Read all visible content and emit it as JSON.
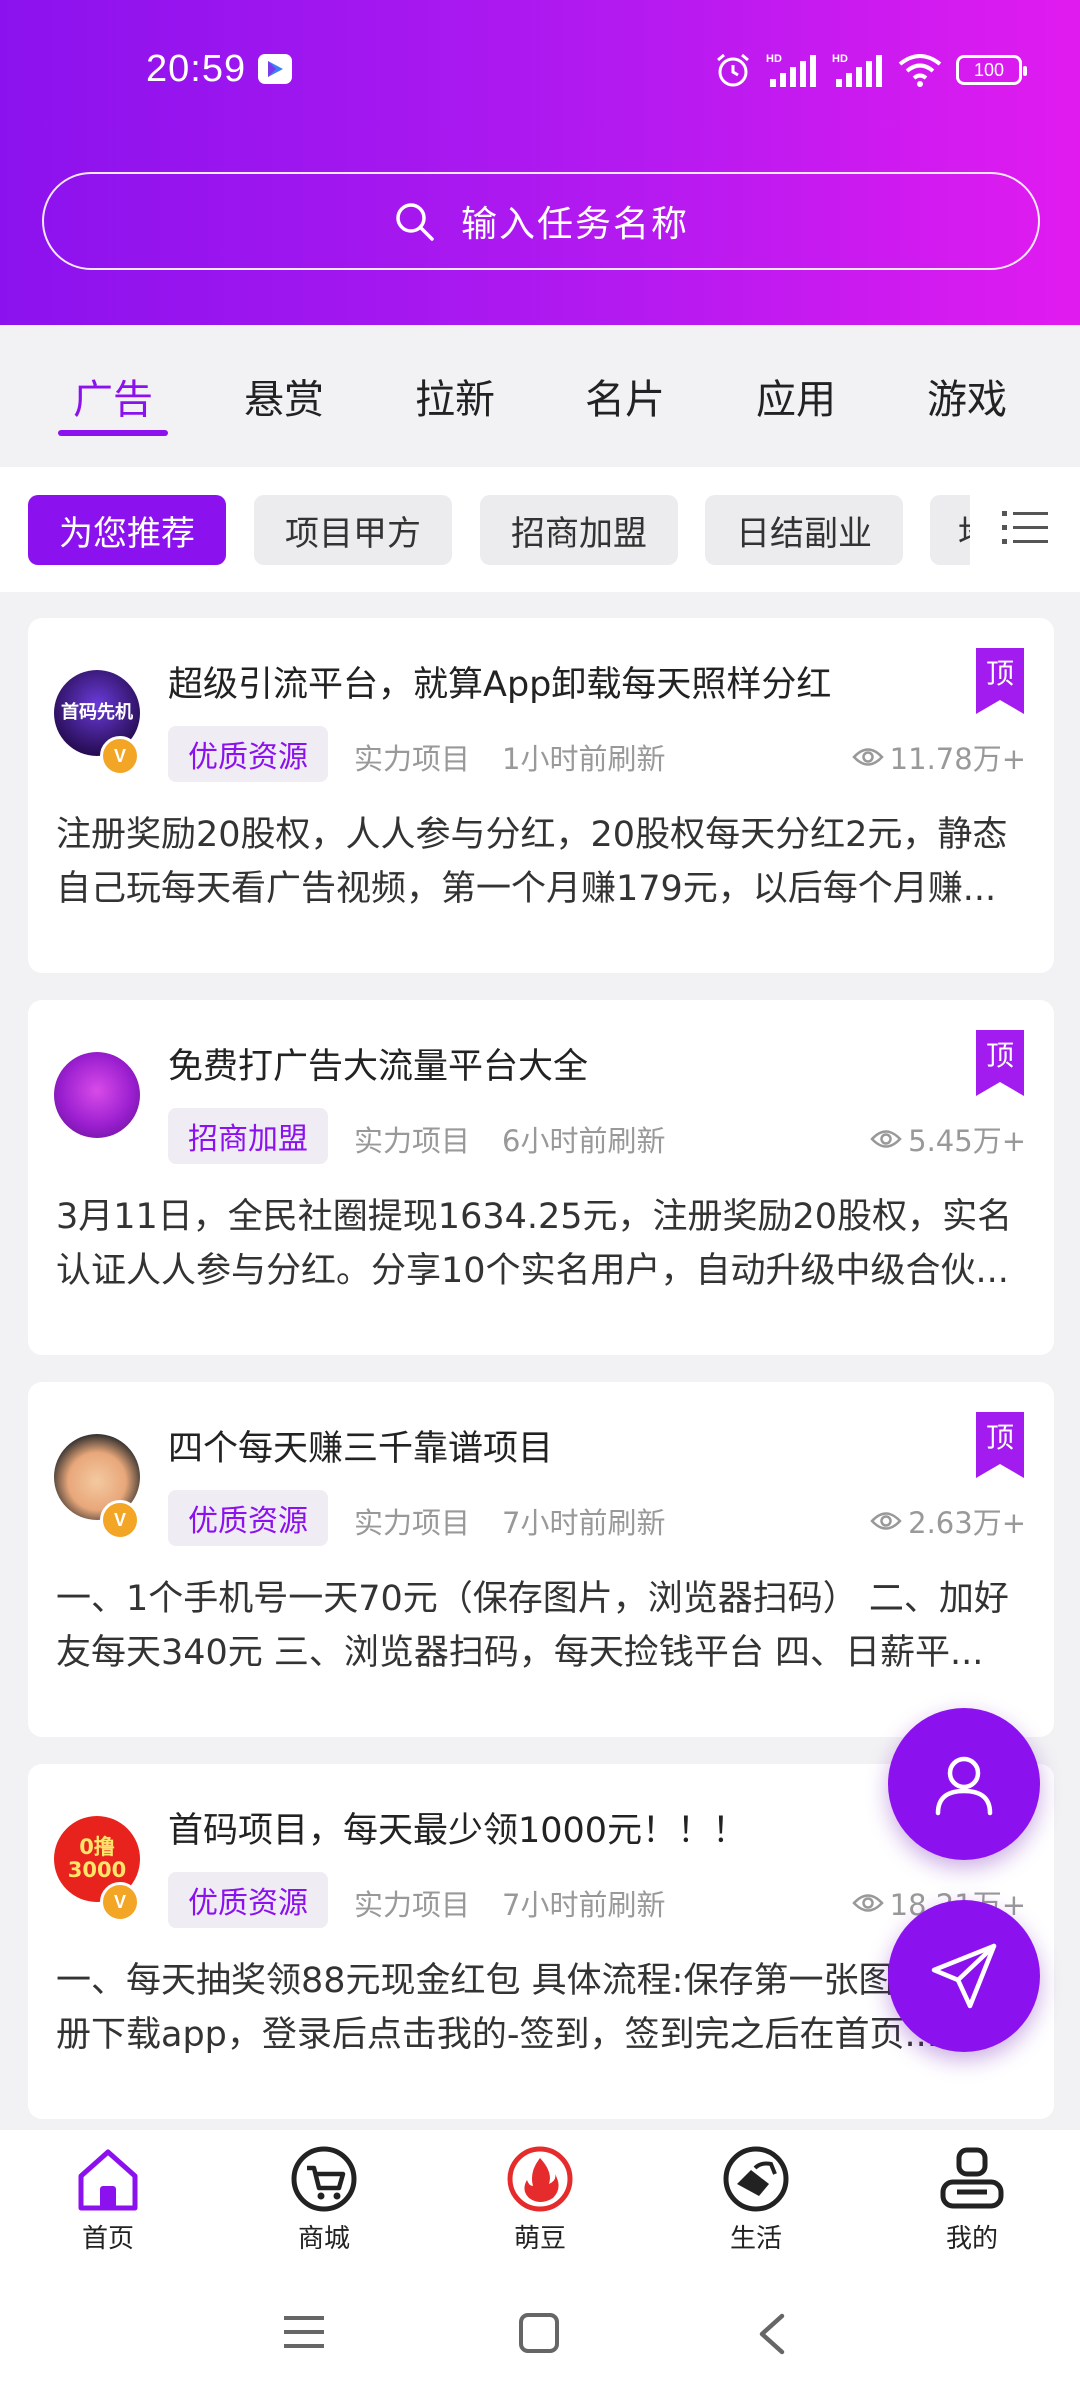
{
  "status": {
    "time": "20:59",
    "battery": "100",
    "network1": "HD",
    "network2": "HD"
  },
  "search": {
    "placeholder": "输入任务名称"
  },
  "categories": [
    {
      "label": "广告",
      "active": true
    },
    {
      "label": "悬赏"
    },
    {
      "label": "拉新"
    },
    {
      "label": "名片"
    },
    {
      "label": "应用"
    },
    {
      "label": "游戏"
    }
  ],
  "chips": [
    {
      "label": "为您推荐",
      "active": true
    },
    {
      "label": "项目甲方"
    },
    {
      "label": "招商加盟"
    },
    {
      "label": "日结副业"
    },
    {
      "label": "地"
    }
  ],
  "cards": [
    {
      "title": "超级引流平台，就算App卸载每天照样分红",
      "tag": "优质资源",
      "meta1": "实力项目",
      "meta2": "1小时前刷新",
      "views": "11.78万+",
      "ribbon": "顶",
      "avatar_text": "首码先机",
      "badge": "V",
      "description": "注册奖励20股权，人人参与分红，20股权每天分红2元，静态自己玩每天看广告视频，第一个月赚179元，以后每个月赚..."
    },
    {
      "title": "免费打广告大流量平台大全",
      "tag": "招商加盟",
      "meta1": "实力项目",
      "meta2": "6小时前刷新",
      "views": "5.45万+",
      "ribbon": "顶",
      "description": "3月11日，全民社圈提现1634.25元，注册奖励20股权，实名认证人人参与分红。分享10个实名用户，自动升级中级合伙..."
    },
    {
      "title": "四个每天赚三千靠谱项目",
      "tag": "优质资源",
      "meta1": "实力项目",
      "meta2": "7小时前刷新",
      "views": "2.63万+",
      "ribbon": "顶",
      "badge": "V",
      "description": "一、1个手机号一天70元（保存图片，浏览器扫码） 二、加好友每天340元 三、浏览器扫码，每天捡钱平台 四、日薪平..."
    },
    {
      "title": "首码项目，每天最少领1000元！！！",
      "tag": "优质资源",
      "meta1": "实力项目",
      "meta2": "7小时前刷新",
      "views": "18.21万+",
      "avatar_text": "0撸3000",
      "badge": "V",
      "description": "一、每天抽奖领88元现金红包 具体流程:保存第一张图片扫码注册下载app，登录后点击我的-签到，签到完之后在首页..."
    }
  ],
  "bottom_nav": [
    {
      "label": "首页",
      "icon": "home-icon"
    },
    {
      "label": "商城",
      "icon": "cart-icon"
    },
    {
      "label": "萌豆",
      "icon": "flame-icon"
    },
    {
      "label": "生活",
      "icon": "fuel-icon"
    },
    {
      "label": "我的",
      "icon": "profile-icon"
    }
  ],
  "colors": {
    "accent": "#8b12ee",
    "accent_end": "#e11bf0",
    "badge": "#f3a526",
    "flame": "#e52b2b"
  }
}
